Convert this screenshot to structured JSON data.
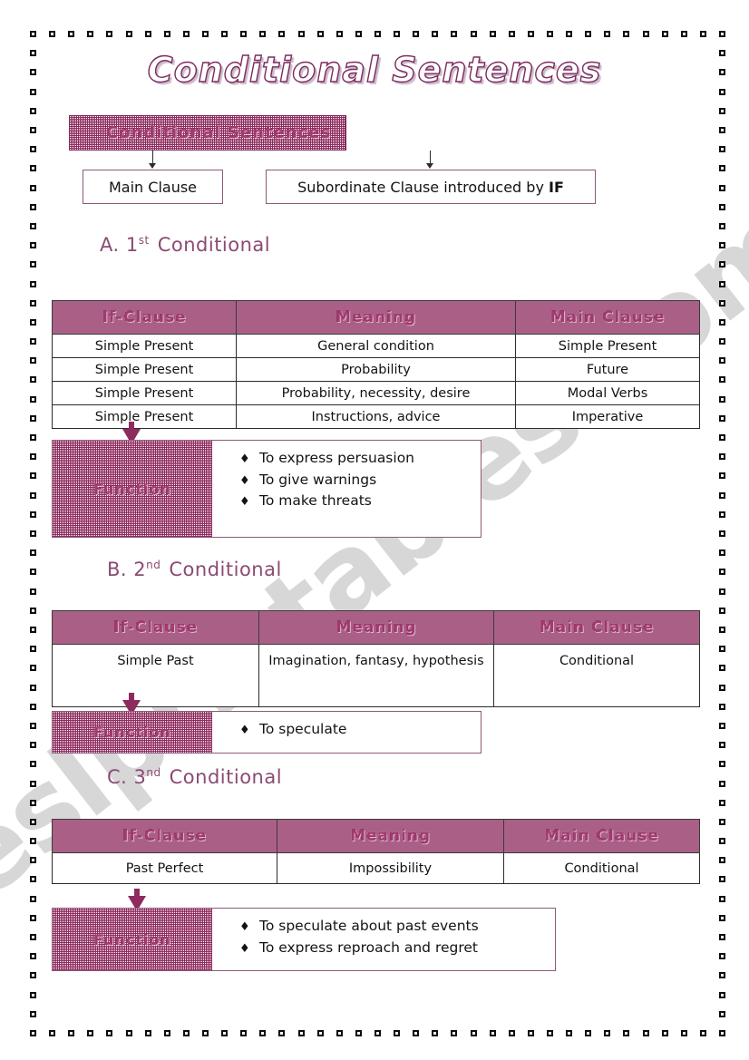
{
  "page": {
    "title": "Conditional Sentences",
    "watermark": "eslprintables.com"
  },
  "colors": {
    "accent_purple": "#8e2b5e",
    "label_purple": "#a03a70",
    "heading_purple": "#8b4a72",
    "box_border": "#8b5a79",
    "table_border": "#2b2b2b",
    "watermark_gray": "#c9c9c9"
  },
  "diagram": {
    "header_label": "Conditional  Sentences",
    "branches": [
      {
        "label": "Main Clause"
      },
      {
        "label_prefix": "Subordinate Clause introduced by ",
        "label_bold": "IF"
      }
    ]
  },
  "sections": [
    {
      "heading_letter": "A.",
      "heading_ordinal": "1",
      "heading_suffix": "st",
      "heading_word": "Conditional",
      "table": {
        "headers": [
          "If-Clause",
          "Meaning",
          "Main Clause"
        ],
        "rows": [
          [
            "Simple Present",
            "General condition",
            "Simple Present"
          ],
          [
            "Simple Present",
            "Probability",
            "Future"
          ],
          [
            "Simple Present",
            "Probability, necessity, desire",
            "Modal Verbs"
          ],
          [
            "Simple Present",
            "Instructions, advice",
            "Imperative"
          ]
        ]
      },
      "function": {
        "label": "Function",
        "items": [
          "To express persuasion",
          "To give warnings",
          "To make threats"
        ]
      }
    },
    {
      "heading_letter": "B.",
      "heading_ordinal": "2",
      "heading_suffix": "nd",
      "heading_word": "Conditional",
      "table": {
        "headers": [
          "If-Clause",
          "Meaning",
          "Main Clause"
        ],
        "rows": [
          [
            "Simple Past",
            "Imagination, fantasy, hypothesis",
            "Conditional"
          ]
        ]
      },
      "function": {
        "label": "Function",
        "items": [
          "To speculate"
        ]
      }
    },
    {
      "heading_letter": "C.",
      "heading_ordinal": "3",
      "heading_suffix": "nd",
      "heading_word": "Conditional",
      "table": {
        "headers": [
          "If-Clause",
          "Meaning",
          "Main Clause"
        ],
        "rows": [
          [
            "Past Perfect",
            "Impossibility",
            "Conditional"
          ]
        ]
      },
      "function": {
        "label": "Function",
        "items": [
          "To speculate about past events",
          "To express reproach and regret"
        ]
      }
    }
  ],
  "bullet_glyph": "♦"
}
